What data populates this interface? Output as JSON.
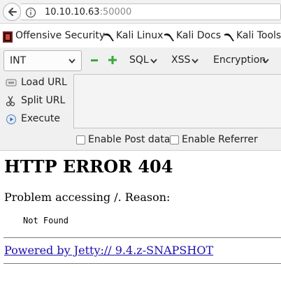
{
  "browser": {
    "url_host": "10.10.10.63",
    "url_port": ":50000"
  },
  "bookmarks": [
    {
      "label": "Offensive Security",
      "icon": "offsec-icon"
    },
    {
      "label": "Kali Linux",
      "icon": "kali-dragon-icon"
    },
    {
      "label": "Kali Docs",
      "icon": "kali-dragon-icon"
    },
    {
      "label": "Kali Tools",
      "icon": "kali-dragon-icon"
    }
  ],
  "hackbar": {
    "select_value": "INT",
    "menus": [
      "SQL",
      "XSS",
      "Encryption"
    ],
    "actions": [
      "Load URL",
      "Split URL",
      "Execute"
    ],
    "checkboxes": [
      "Enable Post data",
      "Enable Referrer"
    ],
    "accent_green": "#3aa83a"
  },
  "page": {
    "title": "HTTP ERROR 404",
    "problem": "Problem accessing /. Reason:",
    "reason": "Not Found",
    "powered_by": "Powered by Jetty:// 9.4.z-SNAPSHOT"
  }
}
